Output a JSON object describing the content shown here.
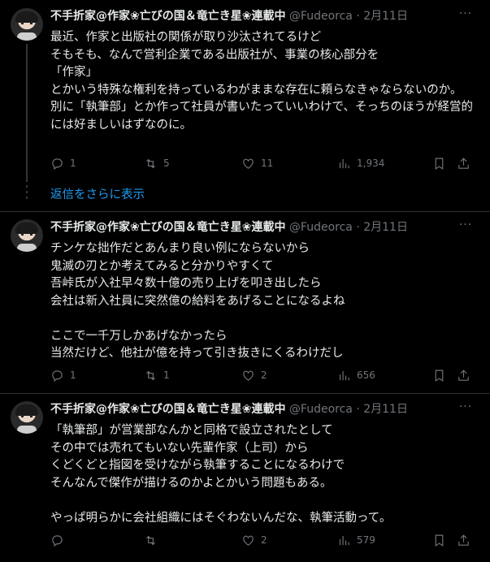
{
  "posts": [
    {
      "author": {
        "name": "不手折家@作家❀亡びの国＆竜亡き星❀連載中",
        "handle": "@Fudeorca",
        "dot": "·",
        "time": "2月11日"
      },
      "more_label": "···",
      "text": "最近、作家と出版社の関係が取り沙汰されてるけど\nそもそも、なんで営利企業である出版社が、事業の核心部分を\n「作家」\nとかいう特殊な権利を持っているわがままな存在に頼らなきゃならないのか。\n別に「執筆部」とか作って社員が書いたっていいわけで、そっちのほうが経営的には好ましいはずなのに。",
      "stats": {
        "replies": "1",
        "reposts": "5",
        "likes": "11",
        "views": "1,934"
      }
    },
    {
      "author": {
        "name": "不手折家@作家❀亡びの国＆竜亡き星❀連載中",
        "handle": "@Fudeorca",
        "dot": "·",
        "time": "2月11日"
      },
      "more_label": "···",
      "text": "チンケな拙作だとあんまり良い例にならないから\n鬼滅の刃とか考えてみると分かりやすくて\n吾峠氏が入社早々数十億の売り上げを叩き出したら\n会社は新入社員に突然億の給料をあげることになるよね\n\nここで一千万しかあげなかったら\n当然だけど、他社が億を持って引き抜きにくるわけだし",
      "stats": {
        "replies": "1",
        "reposts": "1",
        "likes": "2",
        "views": "656"
      }
    },
    {
      "author": {
        "name": "不手折家@作家❀亡びの国＆竜亡き星❀連載中",
        "handle": "@Fudeorca",
        "dot": "·",
        "time": "2月11日"
      },
      "more_label": "···",
      "text": "「執筆部」が営業部なんかと同格で設立されたとして\nその中では売れてもいない先輩作家（上司）から\nくどくどと指図を受けながら執筆することになるわけで\nそんなんで傑作が描けるのかよとかいう問題もある。\n\nやっぱ明らかに会社組織にはそぐわないんだな、執筆活動って。",
      "stats": {
        "replies": "",
        "reposts": "",
        "likes": "2",
        "views": "579"
      }
    }
  ],
  "show_more_replies": "返信をさらに表示",
  "icons": {
    "reply": "reply-icon",
    "repost": "repost-icon",
    "like": "heart-icon",
    "views": "views-icon",
    "bookmark": "bookmark-icon",
    "share": "share-icon"
  },
  "colors": {
    "background": "#000000",
    "text": "#e7e9ea",
    "muted": "#71767b",
    "link": "#1d9bf0",
    "border": "#2f3336"
  }
}
